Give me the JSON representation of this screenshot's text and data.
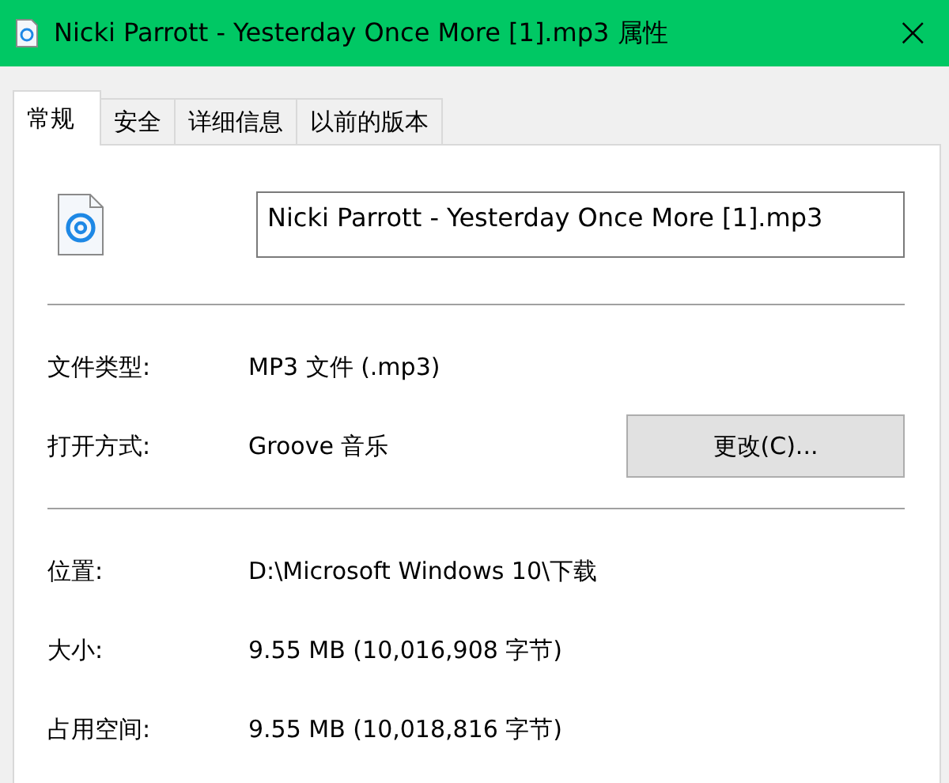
{
  "window": {
    "title": "Nicki Parrott - Yesterday Once More [1].mp3 属性",
    "close": "×"
  },
  "tabs": [
    {
      "label": "常规",
      "selected": true
    },
    {
      "label": "安全",
      "selected": false
    },
    {
      "label": "详细信息",
      "selected": false
    },
    {
      "label": "以前的版本",
      "selected": false
    }
  ],
  "file_name": "Nicki Parrott - Yesterday Once More [1].mp3",
  "sections": [
    {
      "rows": [
        {
          "label": "文件类型:",
          "value": "MP3 文件 (.mp3)"
        },
        {
          "label": "打开方式:",
          "value": "Groove 音乐",
          "button": "更改(C)..."
        }
      ]
    },
    {
      "rows": [
        {
          "label": "位置:",
          "value": "D:\\Microsoft Windows 10\\下载"
        },
        {
          "label": "大小:",
          "value": "9.55 MB (10,016,908 字节)"
        },
        {
          "label": "占用空间:",
          "value": "9.55 MB (10,018,816 字节)"
        }
      ]
    }
  ]
}
